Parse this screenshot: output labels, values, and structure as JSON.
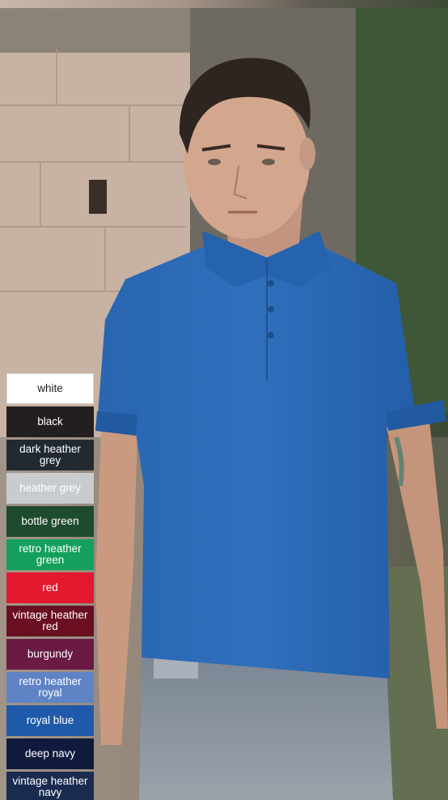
{
  "swatches": [
    {
      "label": "white",
      "color": "#ffffff",
      "light": true
    },
    {
      "label": "black",
      "color": "#231f20"
    },
    {
      "label": "dark heather grey",
      "color": "#222a31"
    },
    {
      "label": "heather grey",
      "color": "#c9ccce"
    },
    {
      "label": "bottle green",
      "color": "#1e4a2e"
    },
    {
      "label": "retro heather green",
      "color": "#14a05c"
    },
    {
      "label": "red",
      "color": "#e4182e"
    },
    {
      "label": "vintage heather red",
      "color": "#6a0e22"
    },
    {
      "label": "burgundy",
      "color": "#6a1a44"
    },
    {
      "label": "retro heather royal",
      "color": "#5f84c6"
    },
    {
      "label": "royal blue",
      "color": "#1f5aaa"
    },
    {
      "label": "deep navy",
      "color": "#101a3c"
    },
    {
      "label": "vintage heather navy",
      "color": "#1a2b50"
    }
  ]
}
